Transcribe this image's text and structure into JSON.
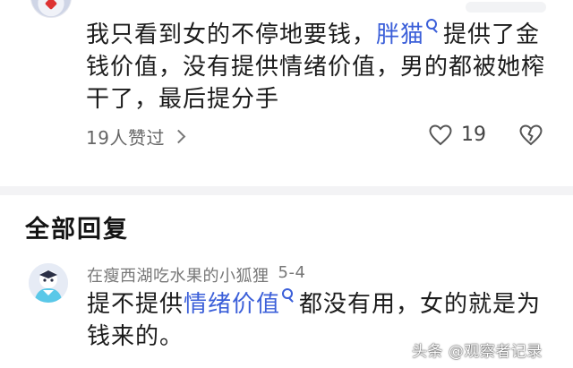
{
  "comment": {
    "text_before": "我只看到女的不停地要钱，",
    "link_text": "胖猫",
    "text_after": "提供了金钱价值，没有提供情绪价值，男的都被她榨干了，最后提分手",
    "replies_label": "19人赞过",
    "like_count": "19"
  },
  "section_title": "全部回复",
  "reply": {
    "author": "在瘦西湖吃水果的小狐狸",
    "date": "5-4",
    "text_before": "提不提供",
    "link_text": "情绪价值",
    "text_after": "都没有用，女的就是为钱来的。"
  },
  "watermark": "头条 @观察者记录",
  "colors": {
    "link": "#3b5fd9",
    "divider": "#f3f3f5"
  },
  "icons": {
    "link_search": "search-icon",
    "replies_more": "chevron-right-icon",
    "like": "heart-icon",
    "dislike": "broken-heart-icon"
  }
}
